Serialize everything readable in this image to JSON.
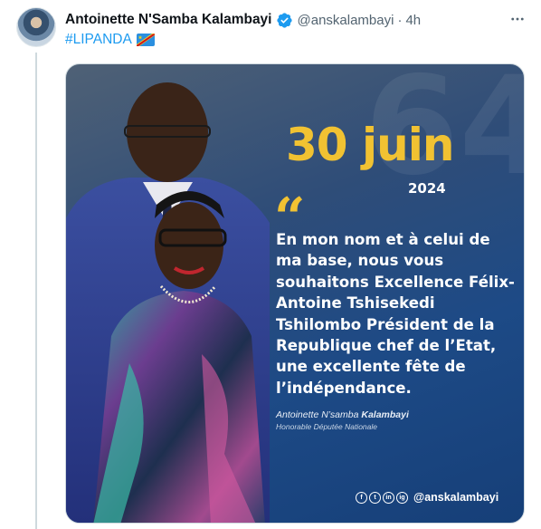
{
  "tweet": {
    "display_name": "Antoinette N'Samba Kalambayi",
    "handle": "@anskalambayi",
    "separator": "·",
    "time": "4h",
    "hashtag": "#LIPANDA",
    "verified_icon": "verified-badge-icon",
    "more_icon": "more-options-icon",
    "flag_icon": "drc-flag-icon"
  },
  "poster": {
    "date_day": "30 juin",
    "date_year": "2024",
    "quote_mark": "“",
    "message": "En mon nom et à celui de ma base, nous vous souhaitons Excellence Félix-Antoine Tshisekedi Tshilombo Président de la Republique chef de l’Etat, une excellente fête de l’indépendance.",
    "signature_first": "Antoinette N’samba ",
    "signature_last": "Kalambayi",
    "signature_title": "Honorable Députée Nationale",
    "social_handle": "@anskalambayi",
    "social_icons": [
      "f",
      "t",
      "in",
      "ig"
    ]
  },
  "colors": {
    "accent": "#1d9bf0",
    "poster_gold": "#f1c232",
    "poster_blue": "#1d4a86"
  }
}
